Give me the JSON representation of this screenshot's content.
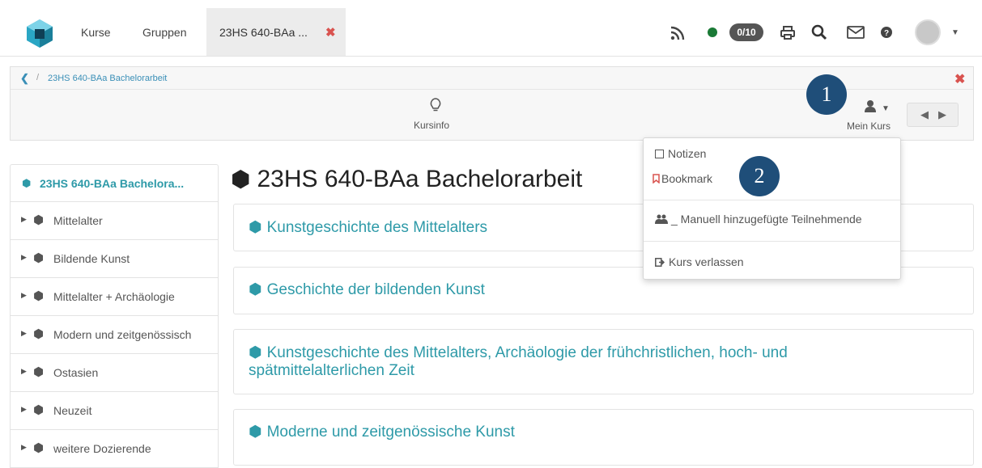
{
  "topnav": {
    "links": [
      "Kurse",
      "Gruppen"
    ],
    "active_tab": {
      "label": "23HS 640-BAa ...",
      "close": "✖"
    },
    "counter": "0/10",
    "icons": [
      "rss-icon",
      "status-dot-icon",
      "print-icon",
      "search-icon",
      "mail-icon",
      "help-icon",
      "avatar"
    ]
  },
  "toolbar": {
    "breadcrumb": {
      "back": "❮",
      "separator": "/",
      "label": "23HS 640-BAa Bachelorarbeit"
    },
    "close": "✖",
    "kursinfo": {
      "icon": "lightbulb-icon",
      "label": "Kursinfo"
    },
    "mein_kurs": {
      "icon": "user-icon",
      "label": "Mein Kurs"
    },
    "pager": {
      "prev": "◀",
      "next": "▶"
    }
  },
  "annotations": {
    "badge1": "1",
    "badge2": "2"
  },
  "sidebar": {
    "header": "23HS 640-BAa Bachelora...",
    "items": [
      {
        "label": "Mittelalter"
      },
      {
        "label": "Bildende Kunst"
      },
      {
        "label": "Mittelalter + Archäologie"
      },
      {
        "label": "Modern und zeitgenössisch"
      },
      {
        "label": "Ostasien"
      },
      {
        "label": "Neuzeit"
      },
      {
        "label": "weitere Dozierende"
      }
    ]
  },
  "main": {
    "title": "23HS 640-BAa Bachelorarbeit",
    "cards": [
      {
        "title": "Kunstgeschichte des Mittelalters"
      },
      {
        "title": "Geschichte der bildenden Kunst"
      },
      {
        "title_line1": "Kunstgeschichte des Mittelalters, Archäologie der frühchristlichen, hoch- und",
        "title_line2": "spätmittelalterlichen Zeit"
      },
      {
        "title": "Moderne und zeitgenössische Kunst"
      }
    ]
  },
  "dropdown": {
    "items": [
      {
        "label": "Notizen",
        "icon": "note-icon"
      },
      {
        "label": "Bookmark",
        "icon": "bookmark-icon",
        "color": "#d9534f"
      },
      {
        "label": "_ Manuell hinzugefügte Teilnehmende",
        "icon": "users-icon"
      },
      {
        "label": "Kurs verlassen",
        "icon": "exit-icon"
      }
    ]
  },
  "colors": {
    "accent": "#2e9aa8",
    "danger": "#d9534f",
    "status": "#1a7a36",
    "badge": "#1f4e79"
  }
}
